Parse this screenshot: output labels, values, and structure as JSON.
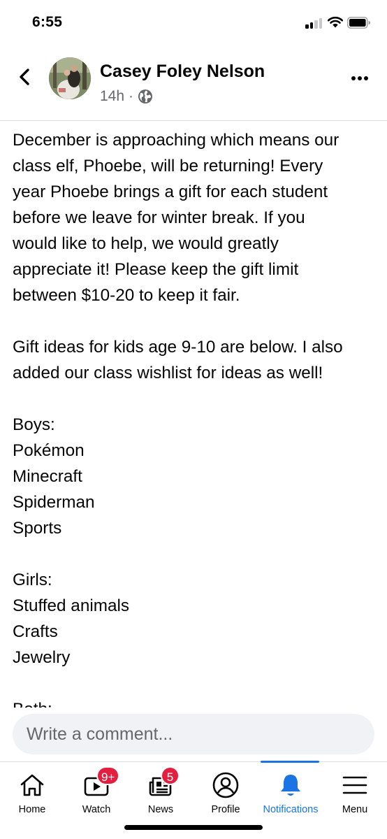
{
  "status_bar": {
    "time": "6:55"
  },
  "post": {
    "author": "Casey Foley Nelson",
    "time_ago": "14h",
    "separator": "·",
    "audience_icon": "globe-icon",
    "paragraphs": [
      {
        "lines": [
          "December is approaching which means our",
          "class elf, Phoebe, will be returning! Every",
          "year Phoebe brings a gift for each student",
          "before we leave for winter break. If you",
          "would like to help, we would greatly",
          "appreciate it! Please keep the gift limit",
          "between $10-20 to keep it fair."
        ]
      },
      {
        "lines": [
          "Gift ideas for kids age 9-10 are below. I also",
          "added our class wishlist for ideas as well!"
        ]
      },
      {
        "lines": [
          "Boys:",
          "Pokémon",
          "Minecraft",
          "Spiderman",
          "Sports"
        ]
      },
      {
        "lines": [
          "Girls:",
          "Stuffed animals",
          "Crafts",
          "Jewelry"
        ]
      },
      {
        "lines": [
          "Both:"
        ]
      }
    ]
  },
  "comment": {
    "placeholder": "Write a comment..."
  },
  "tabs": [
    {
      "label": "Home",
      "icon": "home-icon"
    },
    {
      "label": "Watch",
      "icon": "watch-icon",
      "badge": "9+"
    },
    {
      "label": "News",
      "icon": "news-icon",
      "badge": "5"
    },
    {
      "label": "Profile",
      "icon": "profile-icon"
    },
    {
      "label": "Notifications",
      "icon": "bell-icon",
      "active": true
    },
    {
      "label": "Menu",
      "icon": "menu-icon"
    }
  ],
  "colors": {
    "accent": "#1b74e4",
    "badge": "#e41e3f",
    "secondary_text": "#65676b"
  }
}
